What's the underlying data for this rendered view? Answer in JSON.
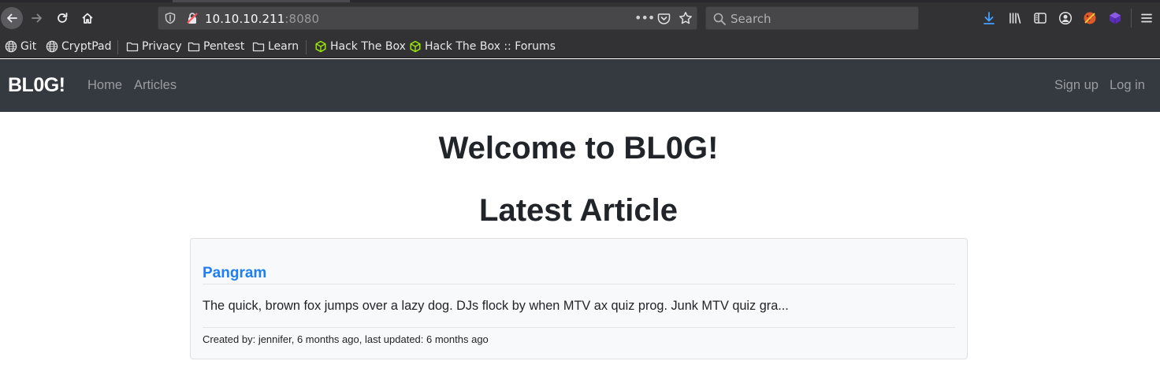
{
  "browser": {
    "url_host": "10.10.10.211",
    "url_port": ":8080",
    "url_menu_dots": "•••",
    "search_placeholder": "Search",
    "bookmarks": [
      {
        "label": "Git",
        "icon": "globe-icon"
      },
      {
        "label": "CryptPad",
        "icon": "globe-icon"
      },
      {
        "label": "Privacy",
        "icon": "folder-icon"
      },
      {
        "label": "Pentest",
        "icon": "folder-icon"
      },
      {
        "label": "Learn",
        "icon": "folder-icon"
      },
      {
        "label": "Hack The Box",
        "icon": "htb-cube-icon"
      },
      {
        "label": "Hack The Box :: Forums",
        "icon": "htb-cube-icon"
      }
    ],
    "colors": {
      "chrome_bg": "#323234",
      "urlbar_bg": "#474749",
      "download_icon": "#45a1ff",
      "htb_green": "#9fef00"
    }
  },
  "site": {
    "brand": "BL0G!",
    "nav_left": [
      "Home",
      "Articles"
    ],
    "nav_right": [
      "Sign up",
      "Log in"
    ],
    "navbar_color": "#343a40"
  },
  "main": {
    "welcome": "Welcome to BL0G!",
    "latest_heading": "Latest Article",
    "article": {
      "title": "Pangram",
      "excerpt": "The quick, brown fox jumps over a lazy dog. DJs flock by when MTV ax quiz prog. Junk MTV quiz gra...",
      "meta": "Created by: jennifer, 6 months ago, last updated: 6 months ago",
      "title_color": "#1e7ef2"
    }
  }
}
